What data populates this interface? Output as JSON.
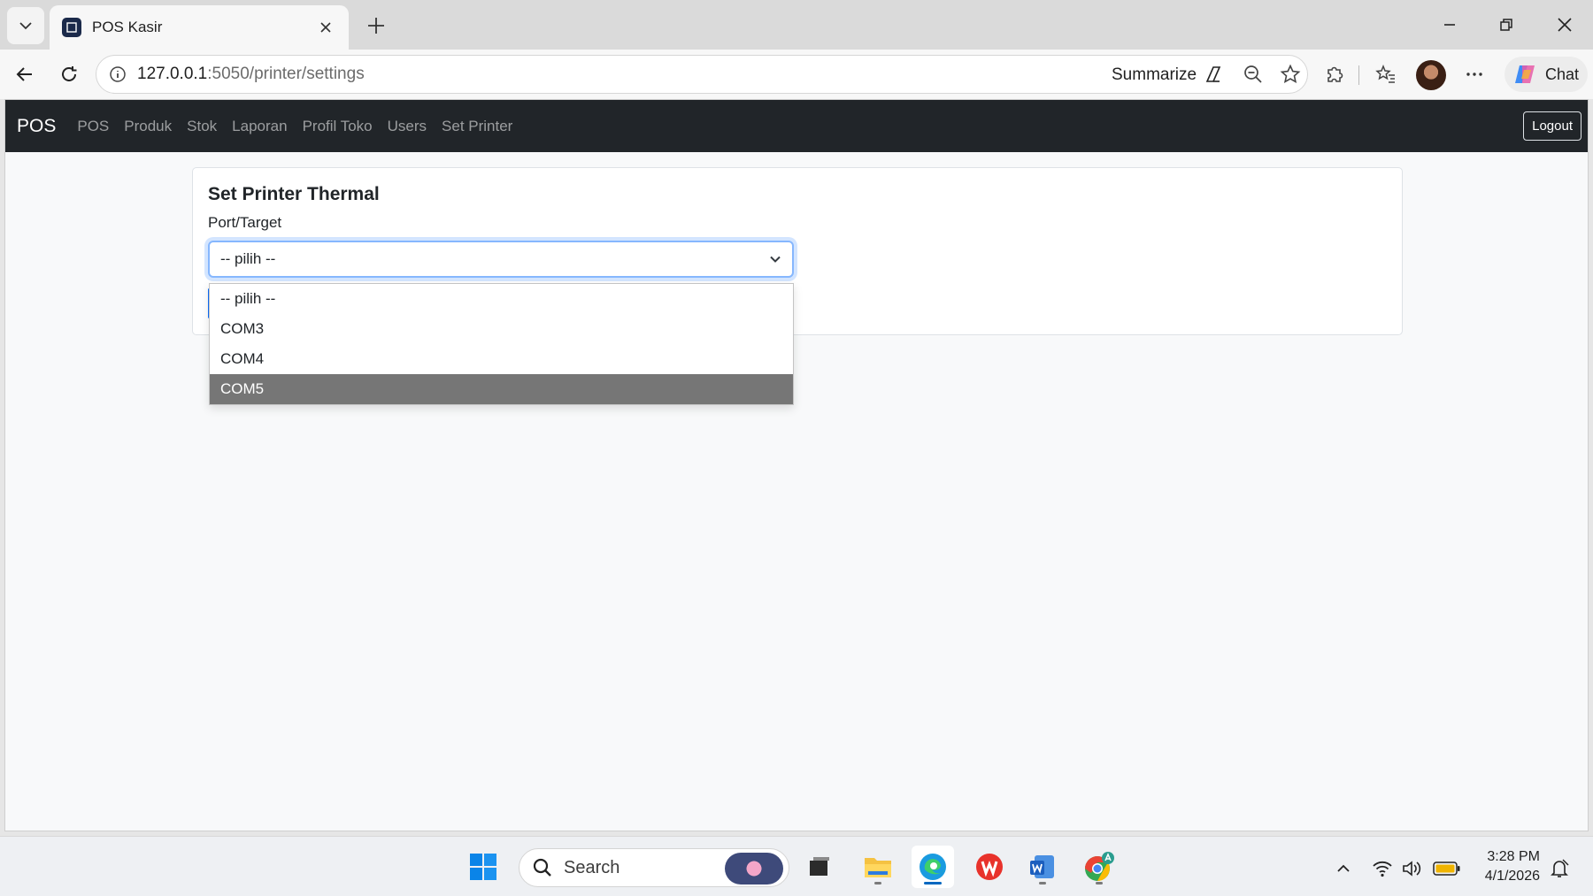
{
  "browser": {
    "tab_title": "POS Kasir",
    "url_host": "127.0.0.1",
    "url_path": ":5050/printer/settings",
    "summarize_label": "Summarize",
    "chat_label": "Chat"
  },
  "navbar": {
    "brand": "POS",
    "links": [
      "POS",
      "Produk",
      "Stok",
      "Laporan",
      "Profil Toko",
      "Users",
      "Set Printer"
    ],
    "logout_label": "Logout"
  },
  "card": {
    "title": "Set Printer Thermal",
    "port_label": "Port/Target",
    "select_value": "-- pilih --",
    "options": [
      "-- pilih --",
      "COM3",
      "COM4",
      "COM5"
    ],
    "highlighted_option": "COM5"
  },
  "taskbar": {
    "search_placeholder": "Search",
    "time": "3:28 PM",
    "date": "4/1/2026"
  },
  "colors": {
    "navbar_bg": "#212529",
    "focus_border": "#86b7fe",
    "highlight": "#767676"
  }
}
